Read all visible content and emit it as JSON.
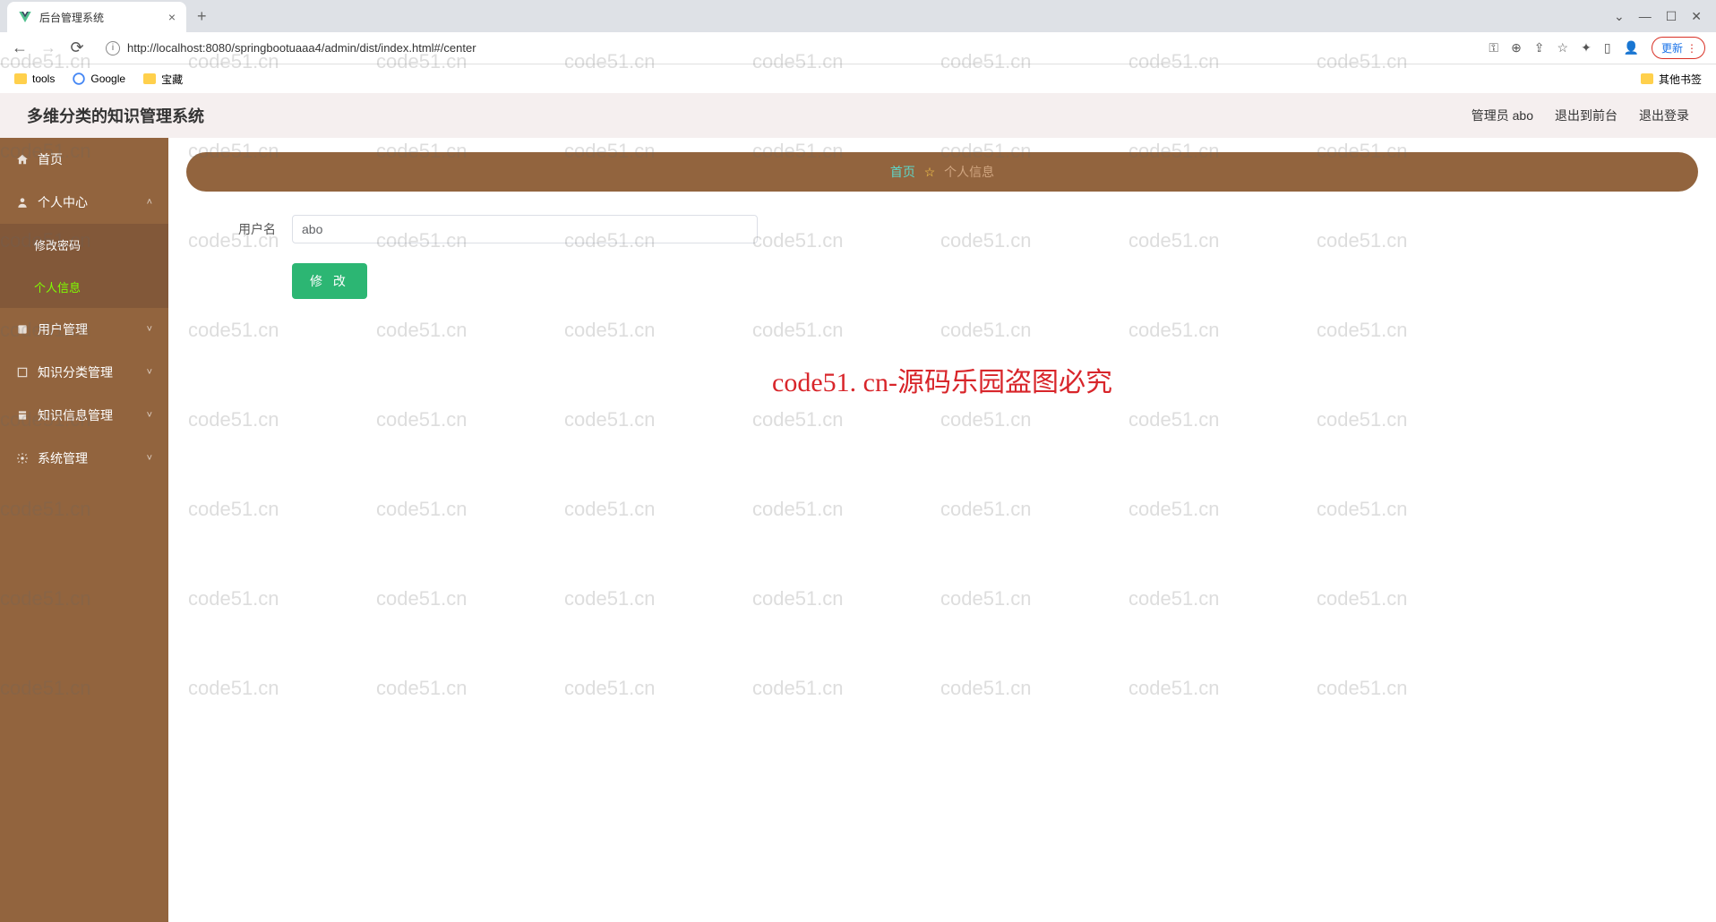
{
  "browser": {
    "tab_title": "后台管理系统",
    "new_tab": "+",
    "url": "http://localhost:8080/springbootuaaa4/admin/dist/index.html#/center",
    "update_label": "更新",
    "window_controls": {
      "expand": "⌄",
      "min": "—",
      "max": "☐",
      "close": "✕"
    }
  },
  "bookmarks": {
    "tools": "tools",
    "google": "Google",
    "treasure": "宝藏",
    "other": "其他书签"
  },
  "header": {
    "title": "多维分类的知识管理系统",
    "admin_label": "管理员 abo",
    "exit_front": "退出到前台",
    "logout": "退出登录"
  },
  "sidebar": {
    "home": "首页",
    "personal_center": "个人中心",
    "modify_password": "修改密码",
    "personal_info": "个人信息",
    "user_mgmt": "用户管理",
    "knowledge_category_mgmt": "知识分类管理",
    "knowledge_info_mgmt": "知识信息管理",
    "system_mgmt": "系统管理"
  },
  "breadcrumb": {
    "home": "首页",
    "star": "☆",
    "current": "个人信息"
  },
  "form": {
    "username_label": "用户名",
    "username_value": "abo",
    "modify_button": "修 改"
  },
  "watermark": {
    "text": "code51.cn",
    "main": "code51. cn-源码乐园盗图必究"
  }
}
